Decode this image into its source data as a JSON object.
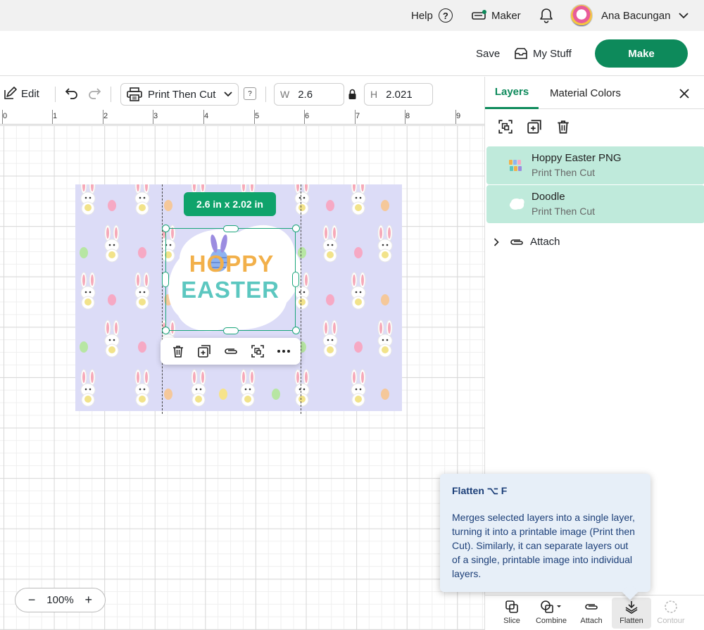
{
  "topbar": {
    "help_label": "Help",
    "help_icon": "?",
    "maker_label": "Maker",
    "user_name": "Ana Bacungan"
  },
  "actionbar": {
    "save_label": "Save",
    "mystuff_label": "My Stuff",
    "make_label": "Make"
  },
  "toolbar": {
    "edit_label": "Edit",
    "operation": "Print Then Cut",
    "help_mark": "?",
    "width_label": "W",
    "width_value": "2.6",
    "height_label": "H",
    "height_value": "2.021"
  },
  "ruler": {
    "ticks": [
      "0",
      "1",
      "2",
      "3",
      "4",
      "5",
      "6",
      "7",
      "8",
      "9"
    ]
  },
  "canvas": {
    "dimension_badge": "2.6  in x 2.02  in",
    "design_title_line1": "HOPPY",
    "design_title_line2": "EASTER",
    "zoom_minus": "−",
    "zoom_level": "100%",
    "zoom_plus": "+"
  },
  "panel": {
    "tab_layers": "Layers",
    "tab_material_colors": "Material Colors",
    "layers": [
      {
        "name": "Hoppy Easter PNG",
        "operation": "Print Then Cut"
      },
      {
        "name": "Doodle",
        "operation": "Print Then Cut"
      }
    ],
    "attach_group_label": "Attach",
    "bottom_tools": {
      "slice": "Slice",
      "combine": "Combine",
      "attach": "Attach",
      "flatten": "Flatten",
      "contour": "Contour"
    }
  },
  "tooltip": {
    "title": "Flatten ⌥ F",
    "body": "Merges selected layers into a single layer, turning it into a printable image (Print then Cut). Similarly, it can separate layers out of a single, printable image into individual layers."
  },
  "colors": {
    "accent": "#0d8a5b",
    "selection": "#1aa57a",
    "layer_highlight": "#bfeadb",
    "design_bg": "#dcdcf7",
    "tooltip_bg": "#e7eff8"
  }
}
